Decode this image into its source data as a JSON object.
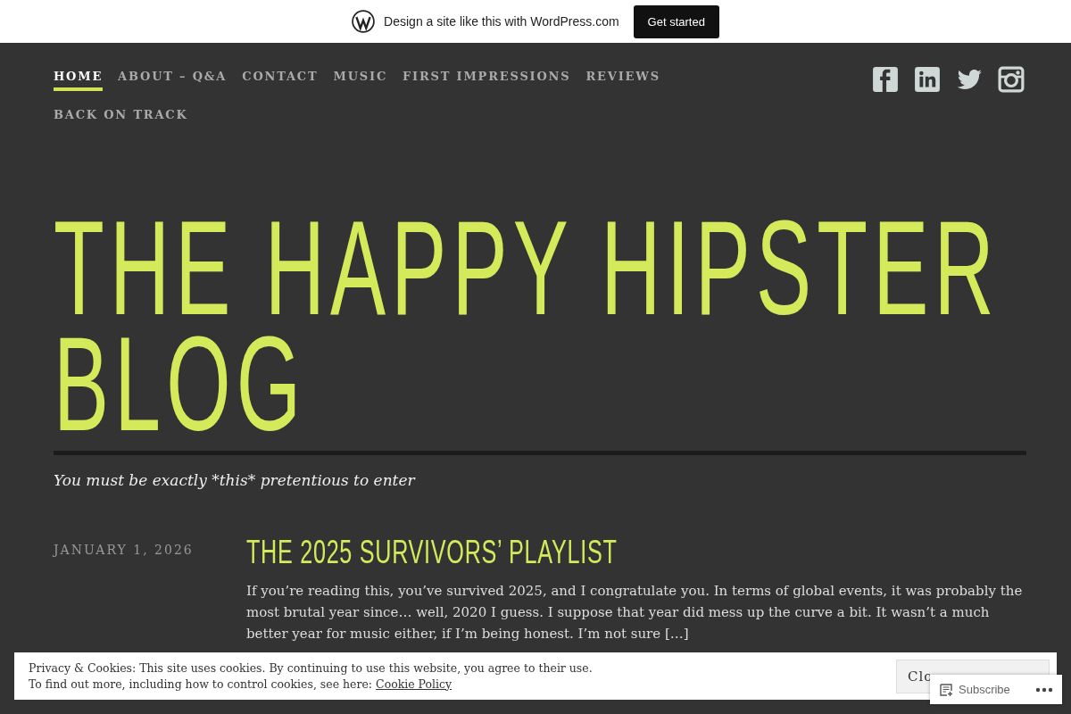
{
  "promo_bar": {
    "text": "Design a site like this with WordPress.com",
    "button": "Get started"
  },
  "nav": {
    "items": [
      {
        "label": "HOME",
        "selected": true
      },
      {
        "label": "ABOUT – Q&A",
        "selected": false
      },
      {
        "label": "CONTACT",
        "selected": false
      },
      {
        "label": "MUSIC",
        "selected": false
      },
      {
        "label": "FIRST IMPRESSIONS",
        "selected": false
      },
      {
        "label": "REVIEWS",
        "selected": false
      },
      {
        "label": "BACK ON TRACK",
        "selected": false
      }
    ]
  },
  "social": [
    {
      "kind": "facebook"
    },
    {
      "kind": "linkedin"
    },
    {
      "kind": "twitter"
    },
    {
      "kind": "instagram"
    }
  ],
  "site": {
    "title": "THE HAPPY HIPSTER BLOG",
    "tagline": "You must be exactly *this* pretentious to enter"
  },
  "posts": [
    {
      "date": "JANUARY 1, 2026",
      "title": "THE 2025 SURVIVORS’ PLAYLIST",
      "excerpt": "If you’re reading this, you’ve survived 2025, and I congratulate you. In terms of global events, it was probably the most brutal year since… well, 2020 I guess. I suppose that year did mess up the curve a bit. It wasn’t a much better year for music either, if I’m being honest. I’m not sure […]"
    }
  ],
  "cookie_banner": {
    "line_1": "Privacy & Cookies: This site uses cookies. By continuing to use this website, you agree to their use.",
    "line_2": "To find out more, including how to control cookies, see here:",
    "link": "Cookie Policy",
    "button": "Clo"
  },
  "subscribe": {
    "label": "Subscribe"
  }
}
